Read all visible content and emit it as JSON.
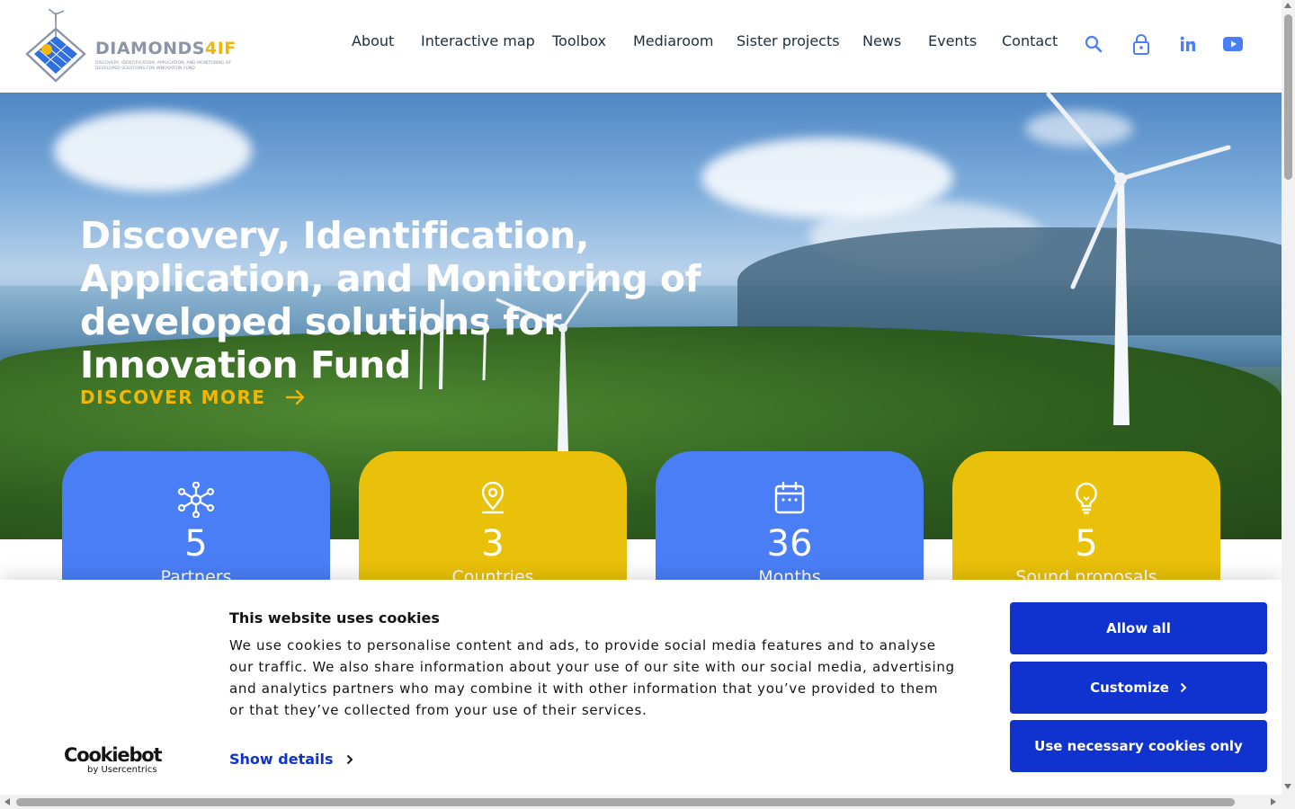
{
  "brand": {
    "name_main": "DIAMONDS",
    "name_accent": "4IF",
    "tagline": "DISCOVERY, IDENTIFICATION, APPLICATION, AND MONITORING OF DEVELOPED SOLUTIONS FOR INNOVATION FUND",
    "colors": {
      "primary_blue": "#4a7ef7",
      "yellow": "#e9c10a",
      "accent_text": "#f2b705",
      "cookie_blue": "#1032cf"
    }
  },
  "nav": {
    "items": [
      {
        "label": "About"
      },
      {
        "label": "Interactive map"
      },
      {
        "label": "Toolbox"
      },
      {
        "label": "Mediaroom"
      },
      {
        "label": "Sister projects"
      },
      {
        "label": "News"
      },
      {
        "label": "Events"
      },
      {
        "label": "Contact"
      }
    ],
    "icons": [
      "search-icon",
      "lock-icon",
      "linkedin-icon",
      "youtube-icon"
    ]
  },
  "hero": {
    "title": "Discovery, Identification, Application, and Monitoring of developed solutions for Innovation Fund",
    "cta_label": "DISCOVER MORE"
  },
  "stats": [
    {
      "value": "5",
      "label": "Partners",
      "icon": "network-icon"
    },
    {
      "value": "3",
      "label": "Countries",
      "icon": "map-pin-icon"
    },
    {
      "value": "36",
      "label": "Months",
      "icon": "calendar-icon"
    },
    {
      "value": "5",
      "label": "Sound proposals",
      "icon": "lightbulb-icon"
    }
  ],
  "cookie_banner": {
    "title": "This website uses cookies",
    "body": "We use cookies to personalise content and ads, to provide social media features and to analyse our traffic. We also share information about your use of our site with our social media, advertising and analytics partners who may combine it with other information that you’ve provided to them or that they’ve collected from your use of their services.",
    "show_details": "Show details",
    "buttons": {
      "allow_all": "Allow all",
      "customize": "Customize",
      "necessary_only": "Use necessary cookies only"
    },
    "provider": {
      "wordmark": "Cookiebot",
      "sub": "by Usercentrics"
    }
  }
}
